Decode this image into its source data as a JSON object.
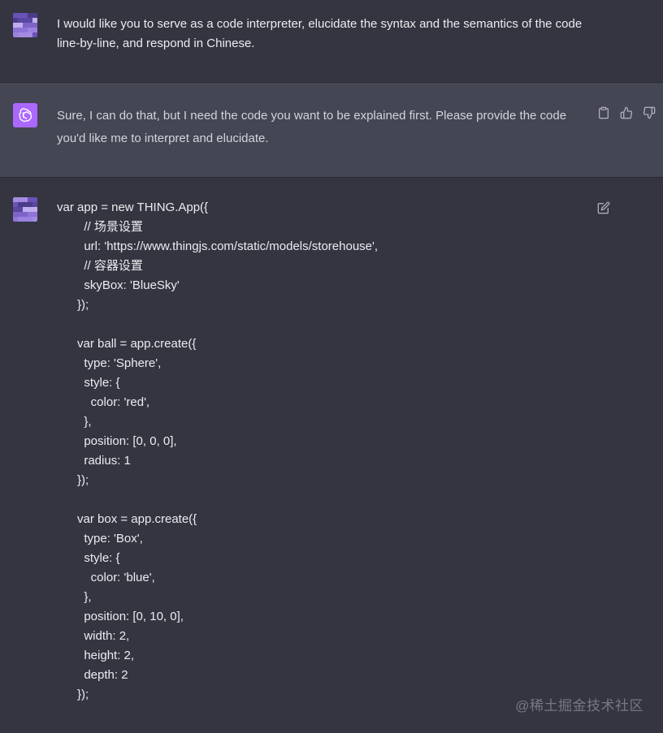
{
  "colors": {
    "page_bg": "#343541",
    "assistant_bg": "#444654",
    "gpt_avatar": "#ab68ff",
    "text": "#ececf1",
    "icon": "#acacbe"
  },
  "messages": {
    "user_1": {
      "text": "I would like you to serve as a code interpreter, elucidate the syntax and the semantics of the code line-by-line, and respond in Chinese."
    },
    "assistant": {
      "text": "Sure, I can do that, but I need the code you want to be explained first. Please provide the code you'd like me to interpret and elucidate.",
      "icons": [
        "clipboard-icon",
        "thumbs-up-icon",
        "thumbs-down-icon"
      ]
    },
    "user_2": {
      "icon": "edit-icon",
      "code_lines": [
        "var app = new THING.App({",
        "        // 场景设置",
        "        url: 'https://www.thingjs.com/static/models/storehouse',",
        "        // 容器设置",
        "        skyBox: 'BlueSky'",
        "      });",
        "",
        "      var ball = app.create({",
        "        type: 'Sphere',",
        "        style: {",
        "          color: 'red',",
        "        },",
        "        position: [0, 0, 0],",
        "        radius: 1",
        "      });",
        "",
        "      var box = app.create({",
        "        type: 'Box',",
        "        style: {",
        "          color: 'blue',",
        "        },",
        "        position: [0, 10, 0],",
        "        width: 2,",
        "        height: 2,",
        "        depth: 2",
        "      });"
      ]
    }
  },
  "watermark": "@稀土掘金技术社区"
}
